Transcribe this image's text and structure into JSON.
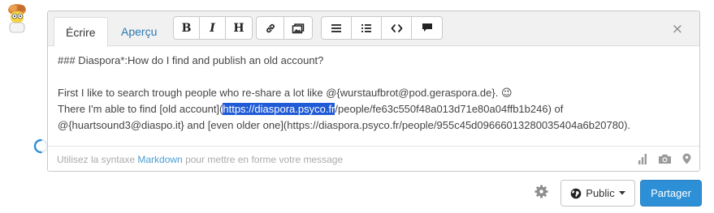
{
  "tabs": {
    "write": "Écrire",
    "preview": "Aperçu"
  },
  "toolbar": {
    "bold": "B",
    "italic": "I",
    "heading": "H",
    "icons": [
      "link-icon",
      "image-icon",
      "ordered-list-icon",
      "bullet-list-icon",
      "code-icon",
      "quote-icon"
    ]
  },
  "close_symbol": "×",
  "message": {
    "line1": "### Diaspora*:How do I find and publish an old account?",
    "line2": "First I like to search trough people who re-share a lot like @{wurstaufbrot@pod.geraspora.de}. 😉",
    "line3_a": "There I'm able to find [old account](",
    "line3_sel": "https://diaspora.psyco.fr",
    "line3_b": "/people/fe63c550f48a013d71e80a04ffb1b246) of",
    "line4": "@{huartsound3@diaspo.it} and [even older one](https://diaspora.psyco.fr/people/955c45d09666013280035404a6b20780)."
  },
  "hint": {
    "before": "Utilisez la syntaxe ",
    "link": "Markdown",
    "after": " pour mettre en forme votre message"
  },
  "footer_icons": [
    "poll-icon",
    "camera-icon",
    "location-icon"
  ],
  "public_label": "Public",
  "share_label": "Partager",
  "colors": {
    "accent": "#2d8fd5",
    "selection": "#1f5bd6",
    "link": "#2a7ab0"
  }
}
